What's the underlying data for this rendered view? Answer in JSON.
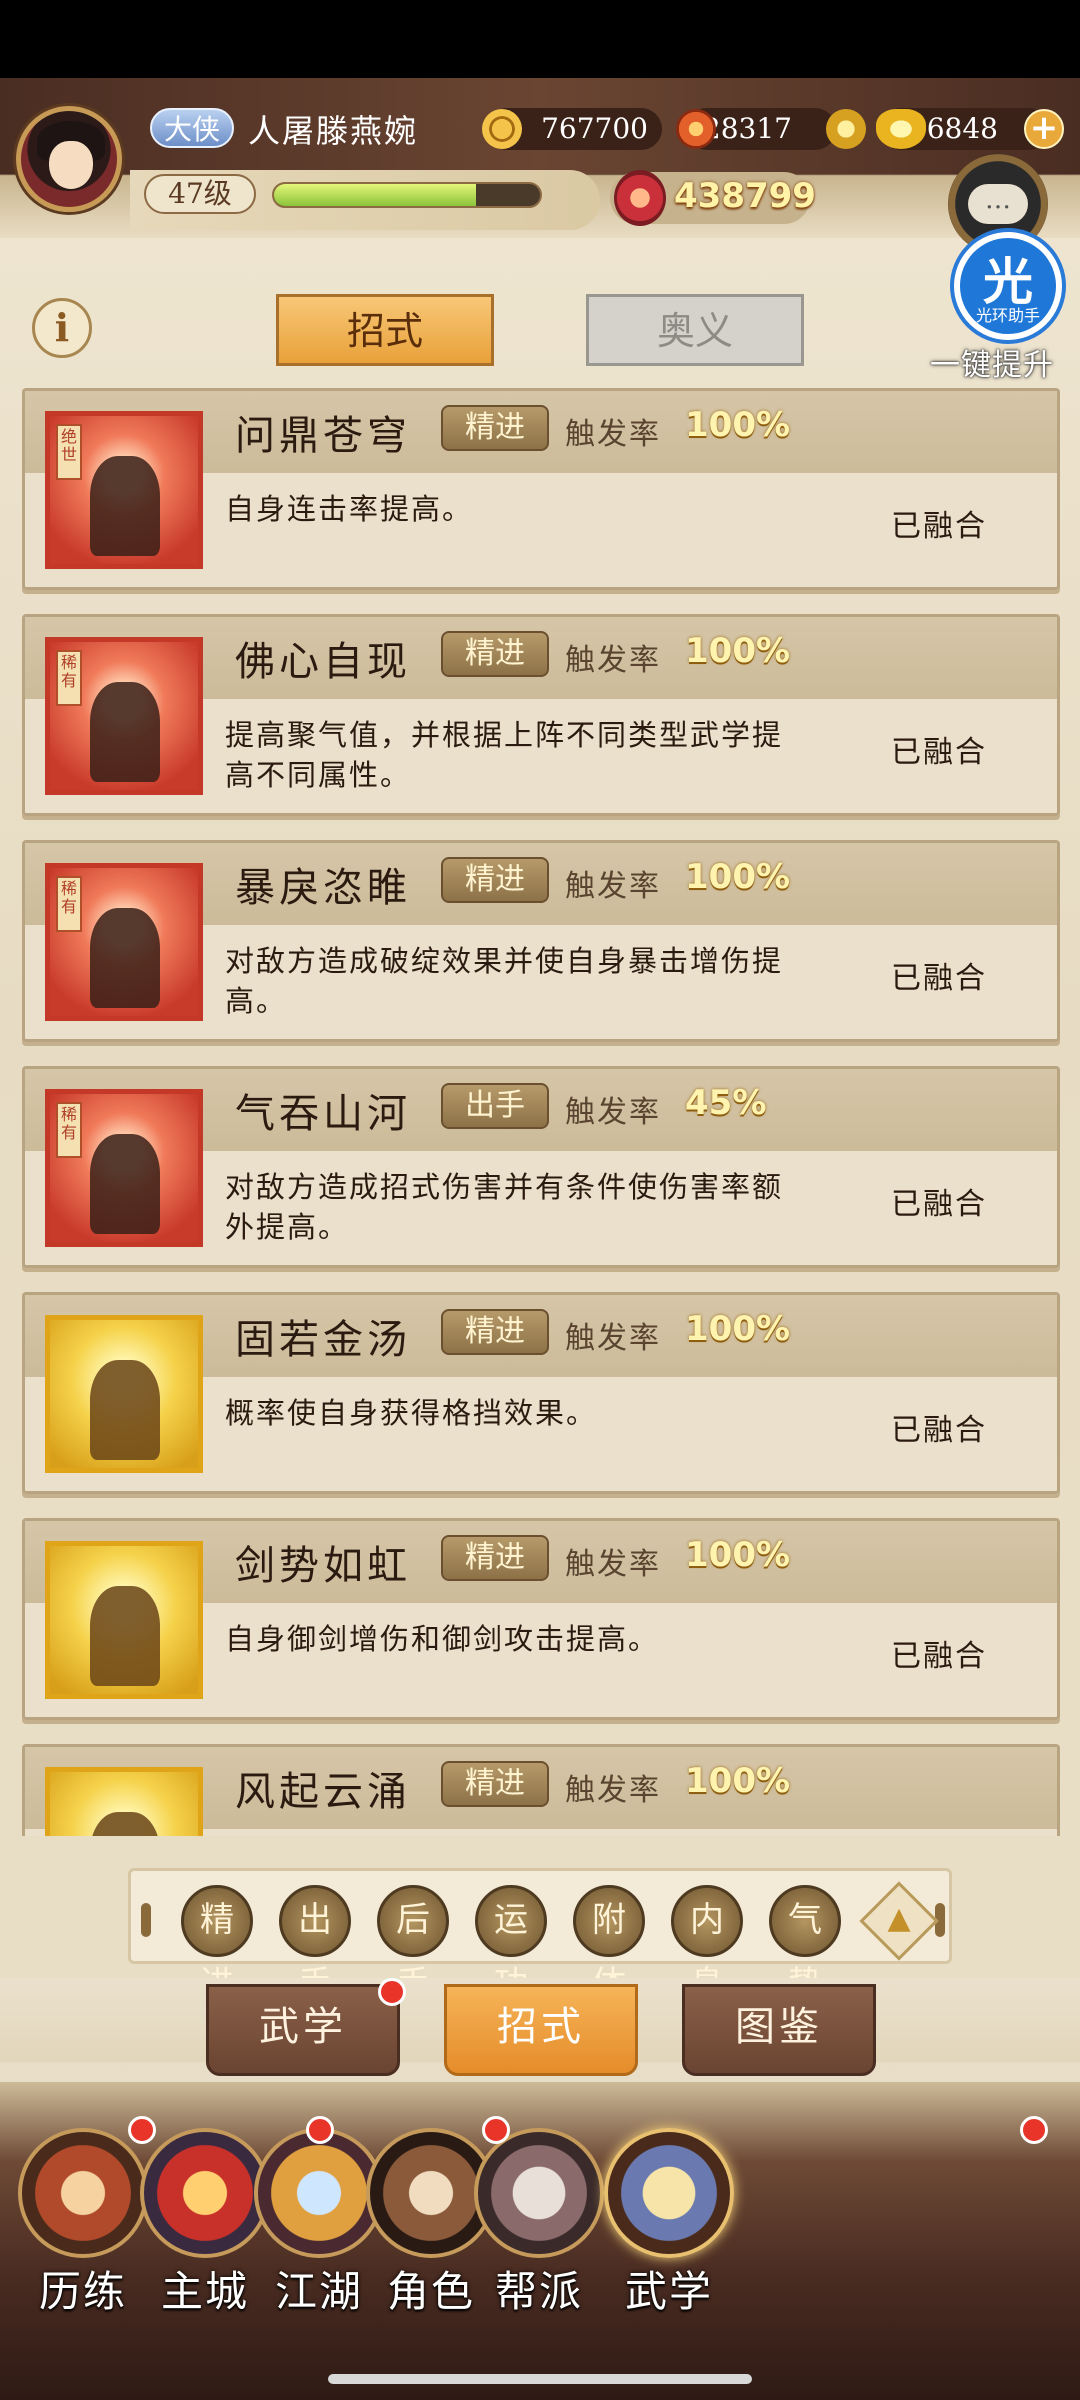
{
  "header": {
    "rank_title": "大侠",
    "player_name": "人屠滕燕婉",
    "level": "47级",
    "exp_progress": 0.76,
    "coins": "767700",
    "stamina": "28317",
    "gold": "6848",
    "power": "438799",
    "chat_icon": "…"
  },
  "helper": {
    "logo_char": "光",
    "logo_label": "光环助手",
    "upgrade_label": "一键提升"
  },
  "tabs": {
    "info": "i",
    "active": "招式",
    "inactive": "奥义"
  },
  "trigger_label": "触发率",
  "skills": [
    {
      "name": "问鼎苍穹",
      "type": "精进",
      "trigger": "100%",
      "desc": "自身连击率提高。",
      "status": "已融合",
      "rarity": "绝世",
      "frame": "red"
    },
    {
      "name": "佛心自现",
      "type": "精进",
      "trigger": "100%",
      "desc": "提高聚气值，并根据上阵不同类型武学提高不同属性。",
      "status": "已融合",
      "rarity": "稀有",
      "frame": "red"
    },
    {
      "name": "暴戾恣睢",
      "type": "精进",
      "trigger": "100%",
      "desc": "对敌方造成破绽效果并使自身暴击增伤提高。",
      "status": "已融合",
      "rarity": "稀有",
      "frame": "red"
    },
    {
      "name": "气吞山河",
      "type": "出手",
      "trigger": "45%",
      "desc": "对敌方造成招式伤害并有条件使伤害率额外提高。",
      "status": "已融合",
      "rarity": "稀有",
      "frame": "red"
    },
    {
      "name": "固若金汤",
      "type": "精进",
      "trigger": "100%",
      "desc": "概率使自身获得格挡效果。",
      "status": "已融合",
      "rarity": "",
      "frame": "gold"
    },
    {
      "name": "剑势如虹",
      "type": "精进",
      "trigger": "100%",
      "desc": "自身御剑增伤和御剑攻击提高。",
      "status": "已融合",
      "rarity": "",
      "frame": "gold"
    },
    {
      "name": "风起云涌",
      "type": "精进",
      "trigger": "100%",
      "desc": "",
      "status": "",
      "rarity": "",
      "frame": "gold"
    }
  ],
  "filters": [
    "精进",
    "出手",
    "后手",
    "运功",
    "附体",
    "内息",
    "气势"
  ],
  "sub_tabs": [
    "武学",
    "招式",
    "图鉴"
  ],
  "nav": [
    "历练",
    "主城",
    "江湖",
    "角色",
    "帮派",
    "武学"
  ],
  "colors": {
    "accent": "#e9a13a",
    "red_dot": "#e9342a",
    "helper_blue": "#1f78d8"
  }
}
